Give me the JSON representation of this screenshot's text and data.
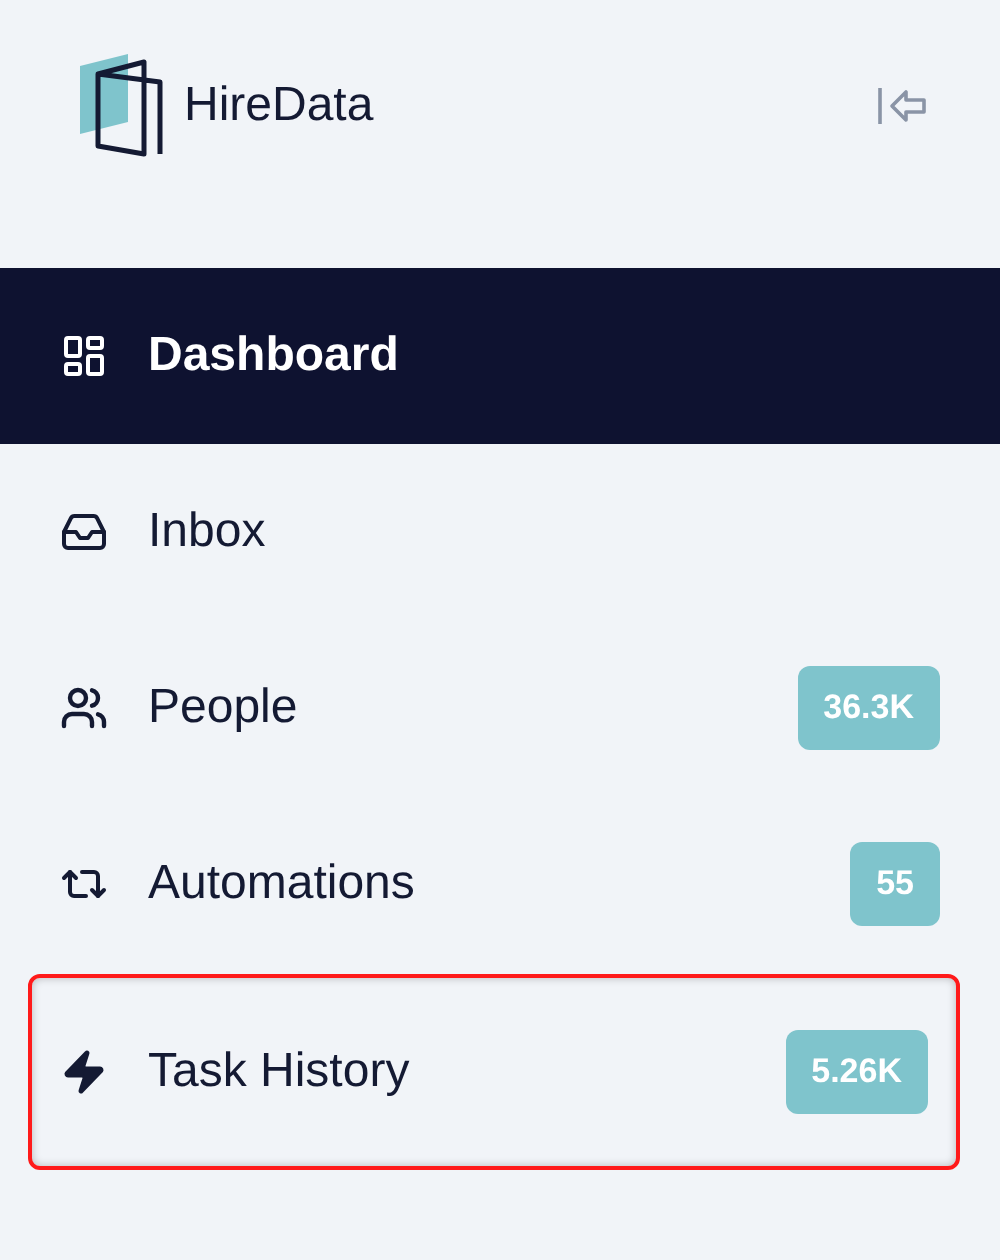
{
  "brand": {
    "name": "HireData"
  },
  "nav": [
    {
      "kind": "dashboard",
      "label": "Dashboard",
      "selected": true,
      "highlighted": false
    },
    {
      "kind": "inbox",
      "label": "Inbox",
      "selected": false,
      "highlighted": false
    },
    {
      "kind": "people",
      "label": "People",
      "count": "36.3K",
      "selected": false,
      "highlighted": false
    },
    {
      "kind": "automations",
      "label": "Automations",
      "count": "55",
      "selected": false,
      "highlighted": false
    },
    {
      "kind": "tasks",
      "label": "Task History",
      "count": "5.26K",
      "selected": false,
      "highlighted": true
    }
  ]
}
